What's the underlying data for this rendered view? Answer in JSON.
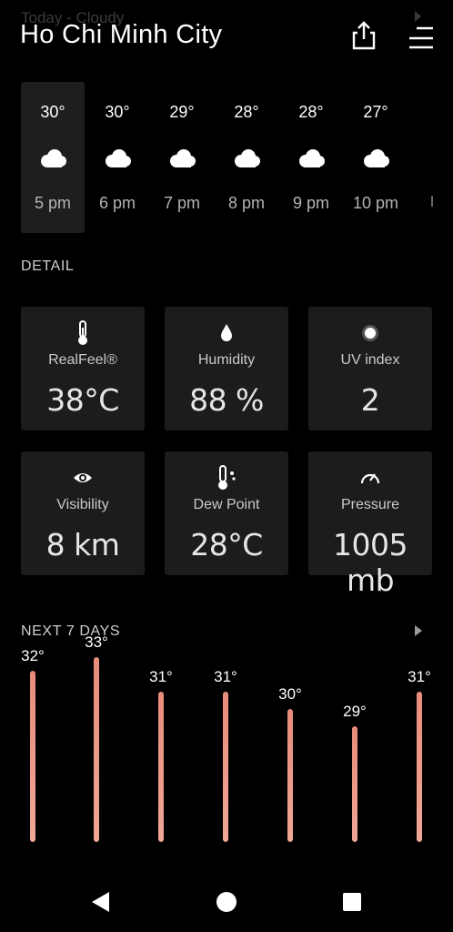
{
  "status": {
    "faded_text": "Today - Cloudy"
  },
  "header": {
    "city": "Ho Chi Minh City",
    "share_icon": "share-icon",
    "menu_icon": "menu-icon"
  },
  "hourly": [
    {
      "temp": "30°",
      "time": "5 pm",
      "icon": "cloud-icon",
      "selected": true
    },
    {
      "temp": "30°",
      "time": "6 pm",
      "icon": "cloud-icon"
    },
    {
      "temp": "29°",
      "time": "7 pm",
      "icon": "cloud-icon"
    },
    {
      "temp": "28°",
      "time": "8 pm",
      "icon": "cloud-icon"
    },
    {
      "temp": "28°",
      "time": "9 pm",
      "icon": "cloud-icon"
    },
    {
      "temp": "27°",
      "time": "10 pm",
      "icon": "cloud-icon"
    }
  ],
  "detail": {
    "title": "DETAIL",
    "cards": [
      {
        "label": "RealFeel®",
        "value": "38°C",
        "icon": "thermometer-icon"
      },
      {
        "label": "Humidity",
        "value": "88 %",
        "icon": "droplet-icon"
      },
      {
        "label": "UV index",
        "value": "2",
        "icon": "sun-icon"
      },
      {
        "label": "Visibility",
        "value": "8 km",
        "icon": "eye-icon"
      },
      {
        "label": "Dew Point",
        "value": "28°C",
        "icon": "dew-point-icon"
      },
      {
        "label": "Pressure",
        "value": "1005 mb",
        "icon": "gauge-icon"
      }
    ]
  },
  "next7": {
    "title": "NEXT 7 DAYS",
    "temps": [
      "32°",
      "33°",
      "31°",
      "31°",
      "30°",
      "29°",
      "31°"
    ]
  },
  "colors": {
    "bar": "#e88c7a",
    "card_bg": "#1c1c1c",
    "selected_bg": "#1e1e1e"
  }
}
